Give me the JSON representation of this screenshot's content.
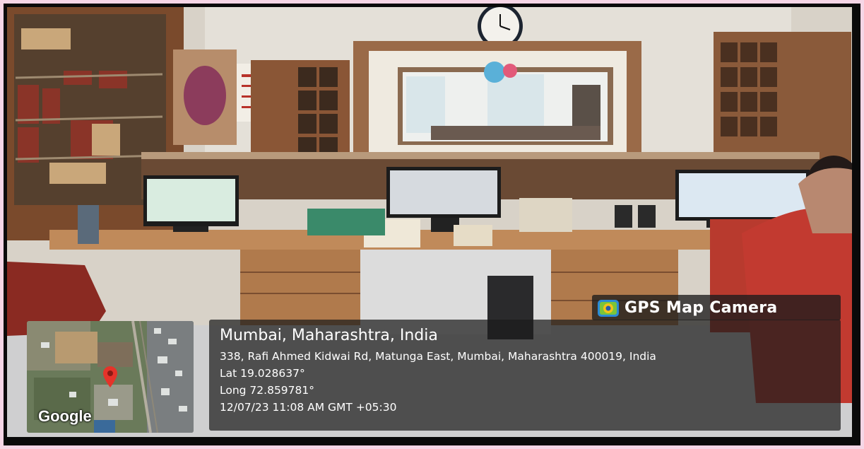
{
  "overlay": {
    "badge_label": "GPS Map Camera",
    "location_title": "Mumbai, Maharashtra, India",
    "address": "338, Rafi Ahmed Kidwai Rd, Matunga East, Mumbai, Maharashtra 400019, India",
    "latitude": "Lat 19.028637°",
    "longitude": "Long 72.859781°",
    "timestamp": "12/07/23 11:08 AM GMT +05:30"
  },
  "map_thumbnail": {
    "brand": "Google",
    "pin_icon": "location-pin-icon"
  },
  "colors": {
    "border": "#0a0a0a",
    "outer_frame": "#f6d6e6",
    "overlay_bg": "#1c1c1c",
    "pin": "#e5332a"
  }
}
